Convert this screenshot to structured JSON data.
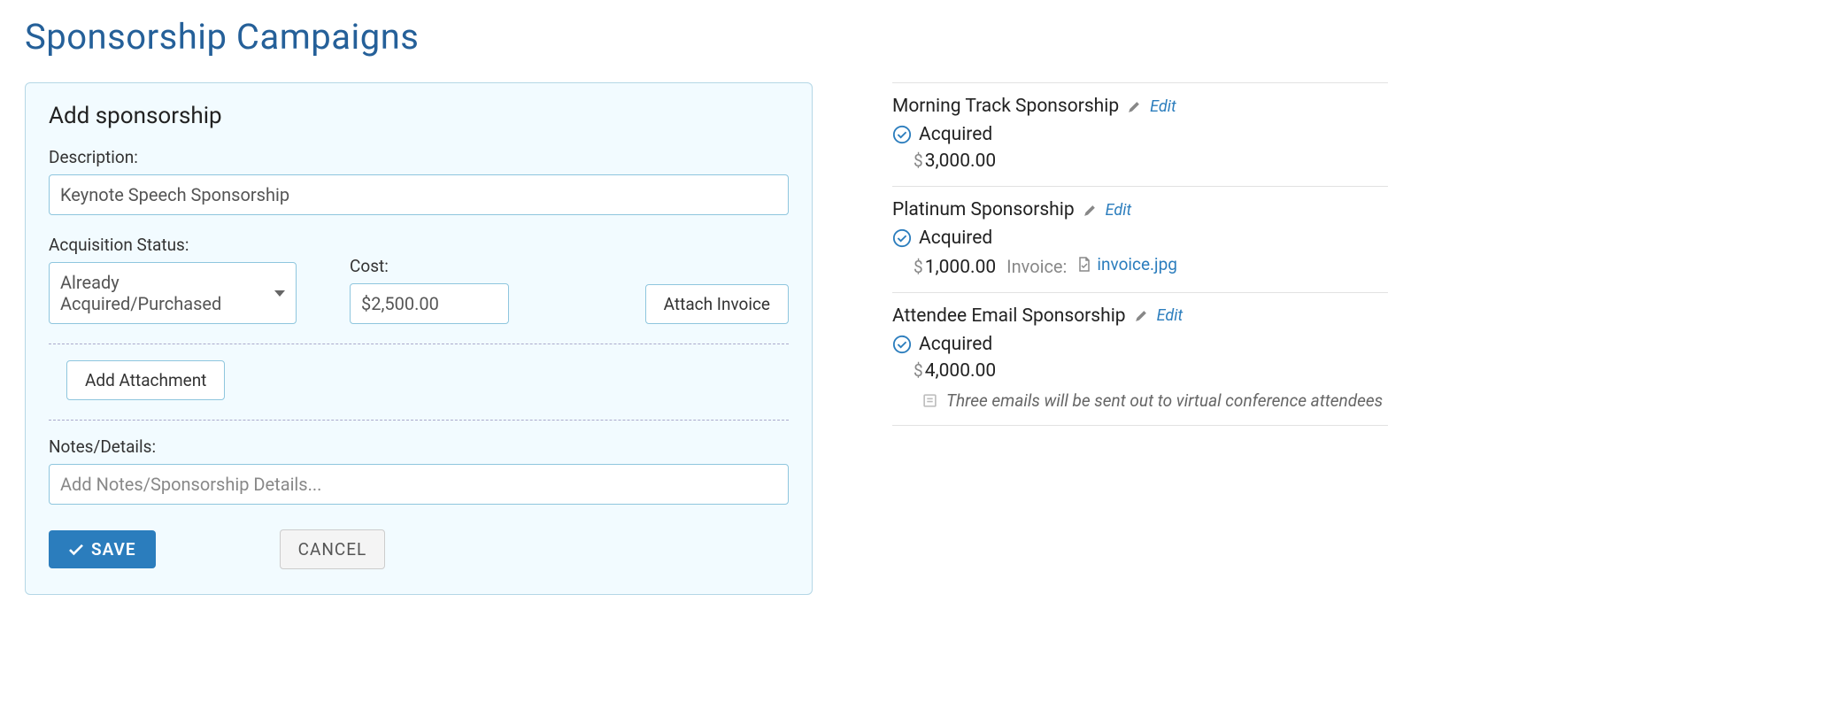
{
  "page": {
    "title": "Sponsorship Campaigns"
  },
  "form": {
    "heading": "Add sponsorship",
    "description_label": "Description:",
    "description_value": "Keynote Speech Sponsorship",
    "status_label": "Acquisition Status:",
    "status_value": "Already Acquired/Purchased",
    "cost_label": "Cost:",
    "cost_value": "$2,500.00",
    "attach_invoice_label": "Attach Invoice",
    "add_attachment_label": "Add Attachment",
    "notes_label": "Notes/Details:",
    "notes_placeholder": "Add Notes/Sponsorship Details...",
    "save_label": "SAVE",
    "cancel_label": "CANCEL"
  },
  "list": {
    "edit_label": "Edit",
    "items": [
      {
        "title": "Morning Track Sponsorship",
        "status": "Acquired",
        "amount": "3,000.00"
      },
      {
        "title": "Platinum Sponsorship",
        "status": "Acquired",
        "amount": "1,000.00",
        "invoice_label": "Invoice:",
        "invoice_name": "invoice.jpg"
      },
      {
        "title": "Attendee Email Sponsorship",
        "status": "Acquired",
        "amount": "4,000.00",
        "note": "Three emails will be sent out to virtual conference attendees"
      }
    ]
  }
}
